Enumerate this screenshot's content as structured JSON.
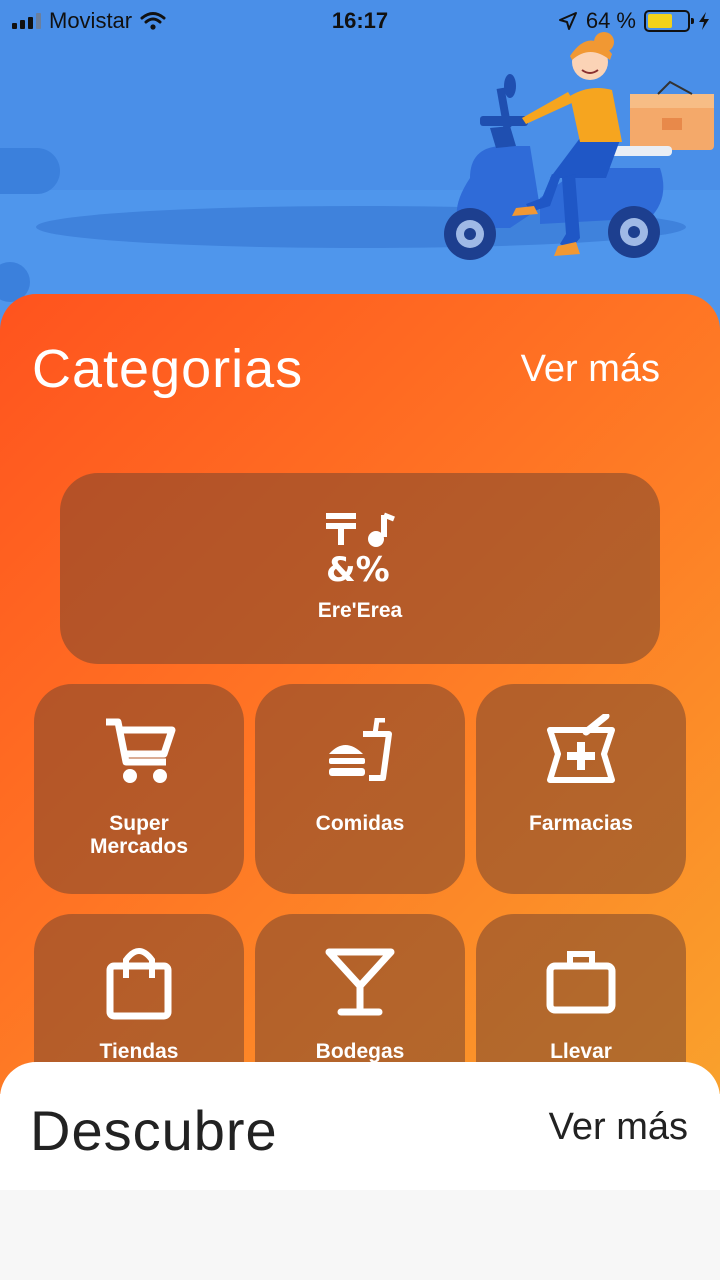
{
  "status_bar": {
    "carrier": "Movistar",
    "time": "16:17",
    "battery_percent": "64 %",
    "icons": [
      "signal-icon",
      "wifi-icon",
      "location-arrow-icon",
      "battery-icon",
      "charging-bolt-icon"
    ]
  },
  "categories_section": {
    "title": "Categorias",
    "see_more": "Ver más",
    "featured": {
      "label": "Ere'Erea",
      "icon": "mixed-symbols-icon"
    },
    "items": [
      {
        "label_lines": [
          "Super",
          "Mercados"
        ],
        "icon": "shopping-cart-icon"
      },
      {
        "label": "Comidas",
        "icon": "fast-food-icon"
      },
      {
        "label": "Farmacias",
        "icon": "pharmacy-mortar-icon"
      },
      {
        "label": "Tiendas",
        "icon": "shopping-bag-icon"
      },
      {
        "label": "Bodegas",
        "icon": "cocktail-glass-icon"
      },
      {
        "label": "Llevar",
        "icon": "briefcase-icon"
      }
    ]
  },
  "discover_section": {
    "title": "Descubre",
    "see_more": "Ver más"
  },
  "colors": {
    "hero_blue": "#4a8fe8",
    "panel_gradient_start": "#ff531e",
    "panel_gradient_end": "#f9a12c",
    "tile_overlay": "rgba(120,70,45,0.55)"
  }
}
